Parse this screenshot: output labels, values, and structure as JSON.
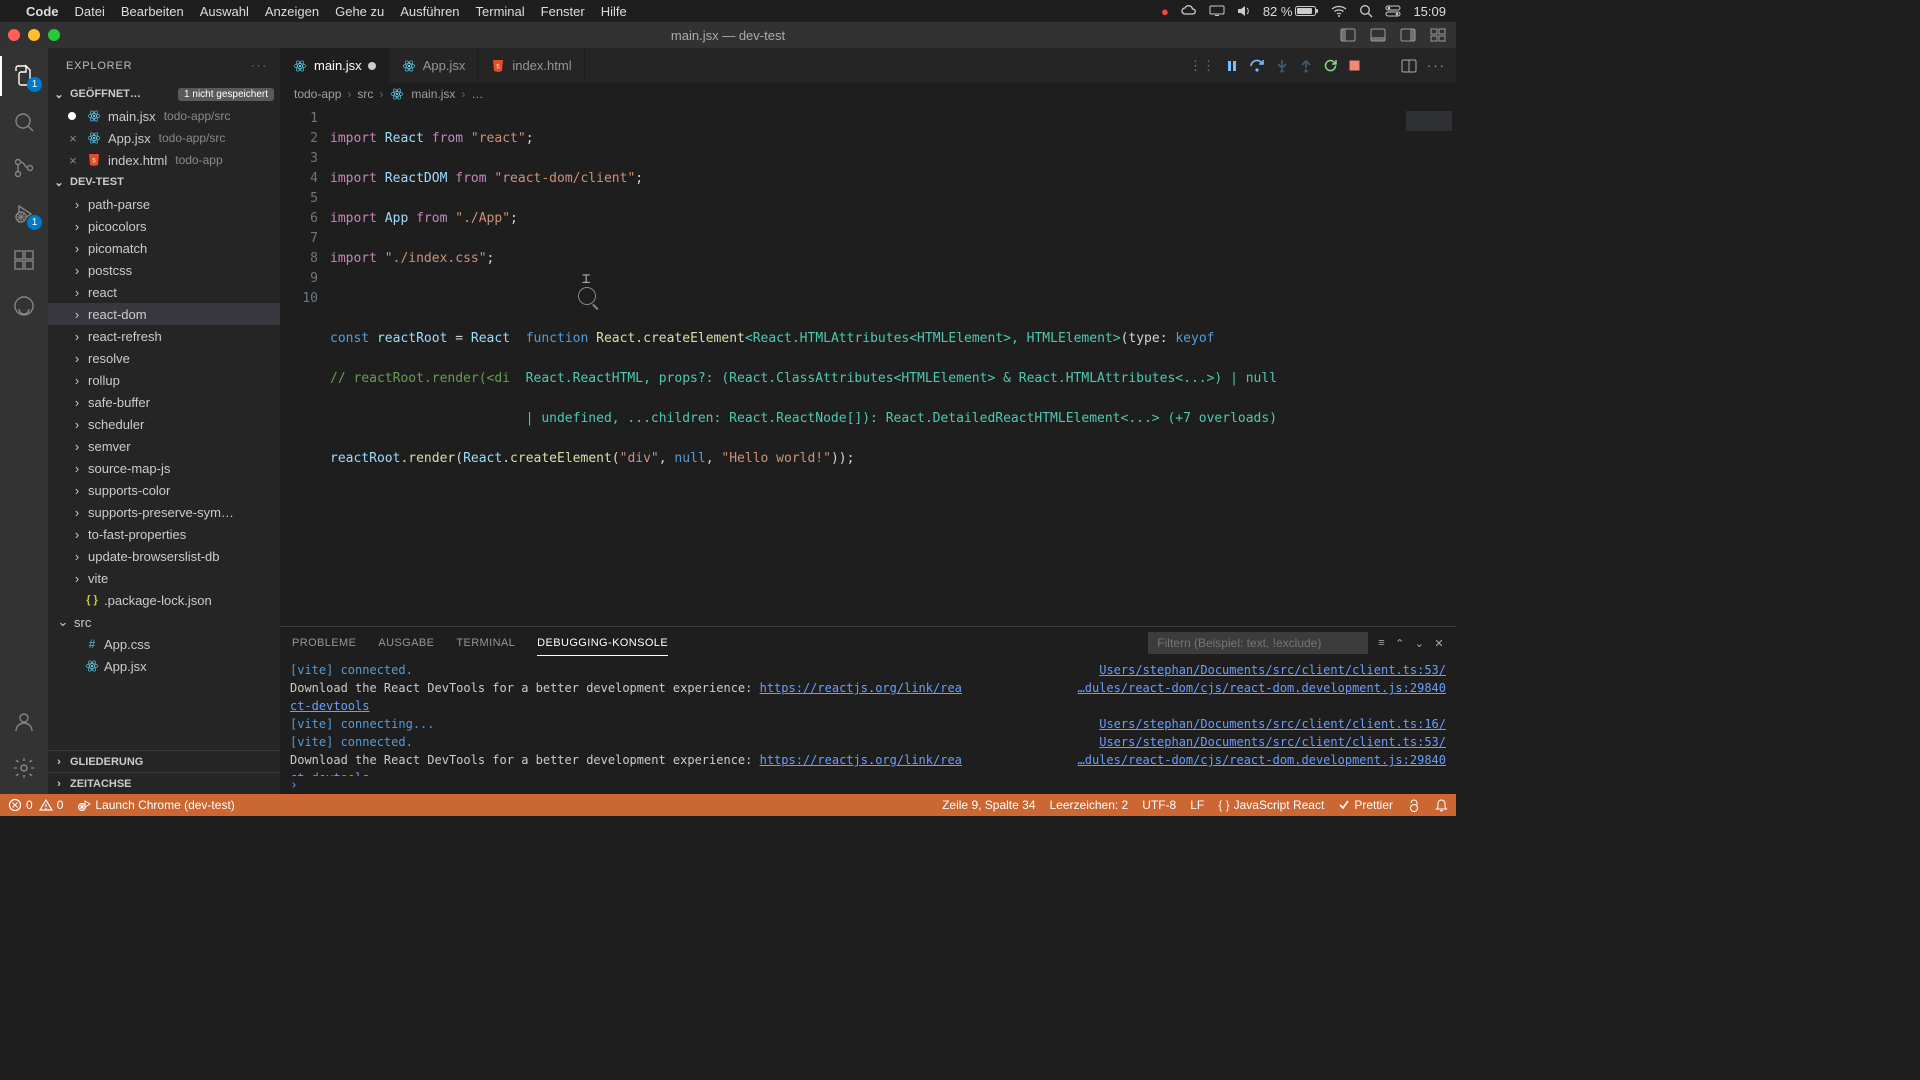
{
  "mac_menu": {
    "app": "Code",
    "items": [
      "Datei",
      "Bearbeiten",
      "Auswahl",
      "Anzeigen",
      "Gehe zu",
      "Ausführen",
      "Terminal",
      "Fenster",
      "Hilfe"
    ],
    "battery": "82 %",
    "time": "15:09"
  },
  "window_title": "main.jsx — dev-test",
  "activity_badges": {
    "explorer": "1",
    "debug": "1"
  },
  "explorer": {
    "title": "EXPLORER",
    "open_editors_label": "GEÖFFNET…",
    "unsaved_label": "1 nicht gespeichert",
    "open_editors": [
      {
        "name": "main.jsx",
        "path": "todo-app/src",
        "icon": "react",
        "dirty": true
      },
      {
        "name": "App.jsx",
        "path": "todo-app/src",
        "icon": "react",
        "dirty": false
      },
      {
        "name": "index.html",
        "path": "todo-app",
        "icon": "html",
        "dirty": false
      }
    ],
    "workspace_label": "DEV-TEST",
    "tree": [
      {
        "name": "path-parse",
        "kind": "folder",
        "depth": 1
      },
      {
        "name": "picocolors",
        "kind": "folder",
        "depth": 1
      },
      {
        "name": "picomatch",
        "kind": "folder",
        "depth": 1
      },
      {
        "name": "postcss",
        "kind": "folder",
        "depth": 1
      },
      {
        "name": "react",
        "kind": "folder",
        "depth": 1
      },
      {
        "name": "react-dom",
        "kind": "folder",
        "depth": 1,
        "selected": true
      },
      {
        "name": "react-refresh",
        "kind": "folder",
        "depth": 1
      },
      {
        "name": "resolve",
        "kind": "folder",
        "depth": 1
      },
      {
        "name": "rollup",
        "kind": "folder",
        "depth": 1
      },
      {
        "name": "safe-buffer",
        "kind": "folder",
        "depth": 1
      },
      {
        "name": "scheduler",
        "kind": "folder",
        "depth": 1
      },
      {
        "name": "semver",
        "kind": "folder",
        "depth": 1
      },
      {
        "name": "source-map-js",
        "kind": "folder",
        "depth": 1
      },
      {
        "name": "supports-color",
        "kind": "folder",
        "depth": 1
      },
      {
        "name": "supports-preserve-sym…",
        "kind": "folder",
        "depth": 1
      },
      {
        "name": "to-fast-properties",
        "kind": "folder",
        "depth": 1
      },
      {
        "name": "update-browserslist-db",
        "kind": "folder",
        "depth": 1
      },
      {
        "name": "vite",
        "kind": "folder",
        "depth": 1
      },
      {
        "name": ".package-lock.json",
        "kind": "file",
        "icon": "json",
        "depth": 1
      },
      {
        "name": "src",
        "kind": "folder",
        "depth": 0,
        "expanded": true
      },
      {
        "name": "App.css",
        "kind": "file",
        "icon": "css",
        "depth": 1
      },
      {
        "name": "App.jsx",
        "kind": "file",
        "icon": "react",
        "depth": 1
      }
    ],
    "outline_label": "GLIEDERUNG",
    "timeline_label": "ZEITACHSE"
  },
  "tabs": [
    {
      "name": "main.jsx",
      "icon": "react",
      "active": true,
      "dirty": true
    },
    {
      "name": "App.jsx",
      "icon": "react",
      "active": false,
      "dirty": false
    },
    {
      "name": "index.html",
      "icon": "html",
      "active": false,
      "dirty": false
    }
  ],
  "breadcrumbs": [
    "todo-app",
    "src",
    "main.jsx",
    "…"
  ],
  "code": {
    "lines": 10,
    "tooltip_l1_a": "function",
    "tooltip_l1_b": " React.createElement",
    "tooltip_l1_c": "<React.HTMLAttributes<HTMLElement>, HTMLElement>",
    "tooltip_l1_d": "(type: ",
    "tooltip_l1_e": "keyof",
    "tooltip_l2": "React.ReactHTML, props?: (React.ClassAttributes<HTMLElement> & React.HTMLAttributes<...>) | null",
    "tooltip_l3": "| undefined, ...children: React.ReactNode[]): React.DetailedReactHTMLElement<...> (+7 overloads)"
  },
  "panel": {
    "tabs": [
      "PROBLEME",
      "AUSGABE",
      "TERMINAL",
      "DEBUGGING-KONSOLE"
    ],
    "filter_placeholder": "Filtern (Beispiel: text, !exclude)",
    "lines": [
      {
        "msg_html": "<span class='vite-b'>[vite] connected.</span>",
        "src": "Users/stephan/Documents/src/client/client.ts:53/"
      },
      {
        "msg_html": "Download the React DevTools for a better development experience: <span class='url-b'>https://reactjs.org/link/rea</span>",
        "src": "…dules/react-dom/cjs/react-dom.development.js:29840"
      },
      {
        "msg_html": "<span class='url-b'>ct-devtools</span>",
        "src": ""
      },
      {
        "msg_html": "<span class='vite-b'>[vite] connecting...</span>",
        "src": "Users/stephan/Documents/src/client/client.ts:16/"
      },
      {
        "msg_html": "<span class='vite-b'>[vite] connected.</span>",
        "src": "Users/stephan/Documents/src/client/client.ts:53/"
      },
      {
        "msg_html": "Download the React DevTools for a better development experience: <span class='url-b'>https://reactjs.org/link/rea</span>",
        "src": "…dules/react-dom/cjs/react-dom.development.js:29840"
      },
      {
        "msg_html": "<span class='url-b'>ct-devtools</span>",
        "src": ""
      }
    ]
  },
  "status": {
    "errors": "0",
    "warnings": "0",
    "launch": "Launch Chrome (dev-test)",
    "pos": "Zeile 9, Spalte 34",
    "spaces": "Leerzeichen: 2",
    "encoding": "UTF-8",
    "eol": "LF",
    "lang": "JavaScript React",
    "prettier": "Prettier"
  }
}
